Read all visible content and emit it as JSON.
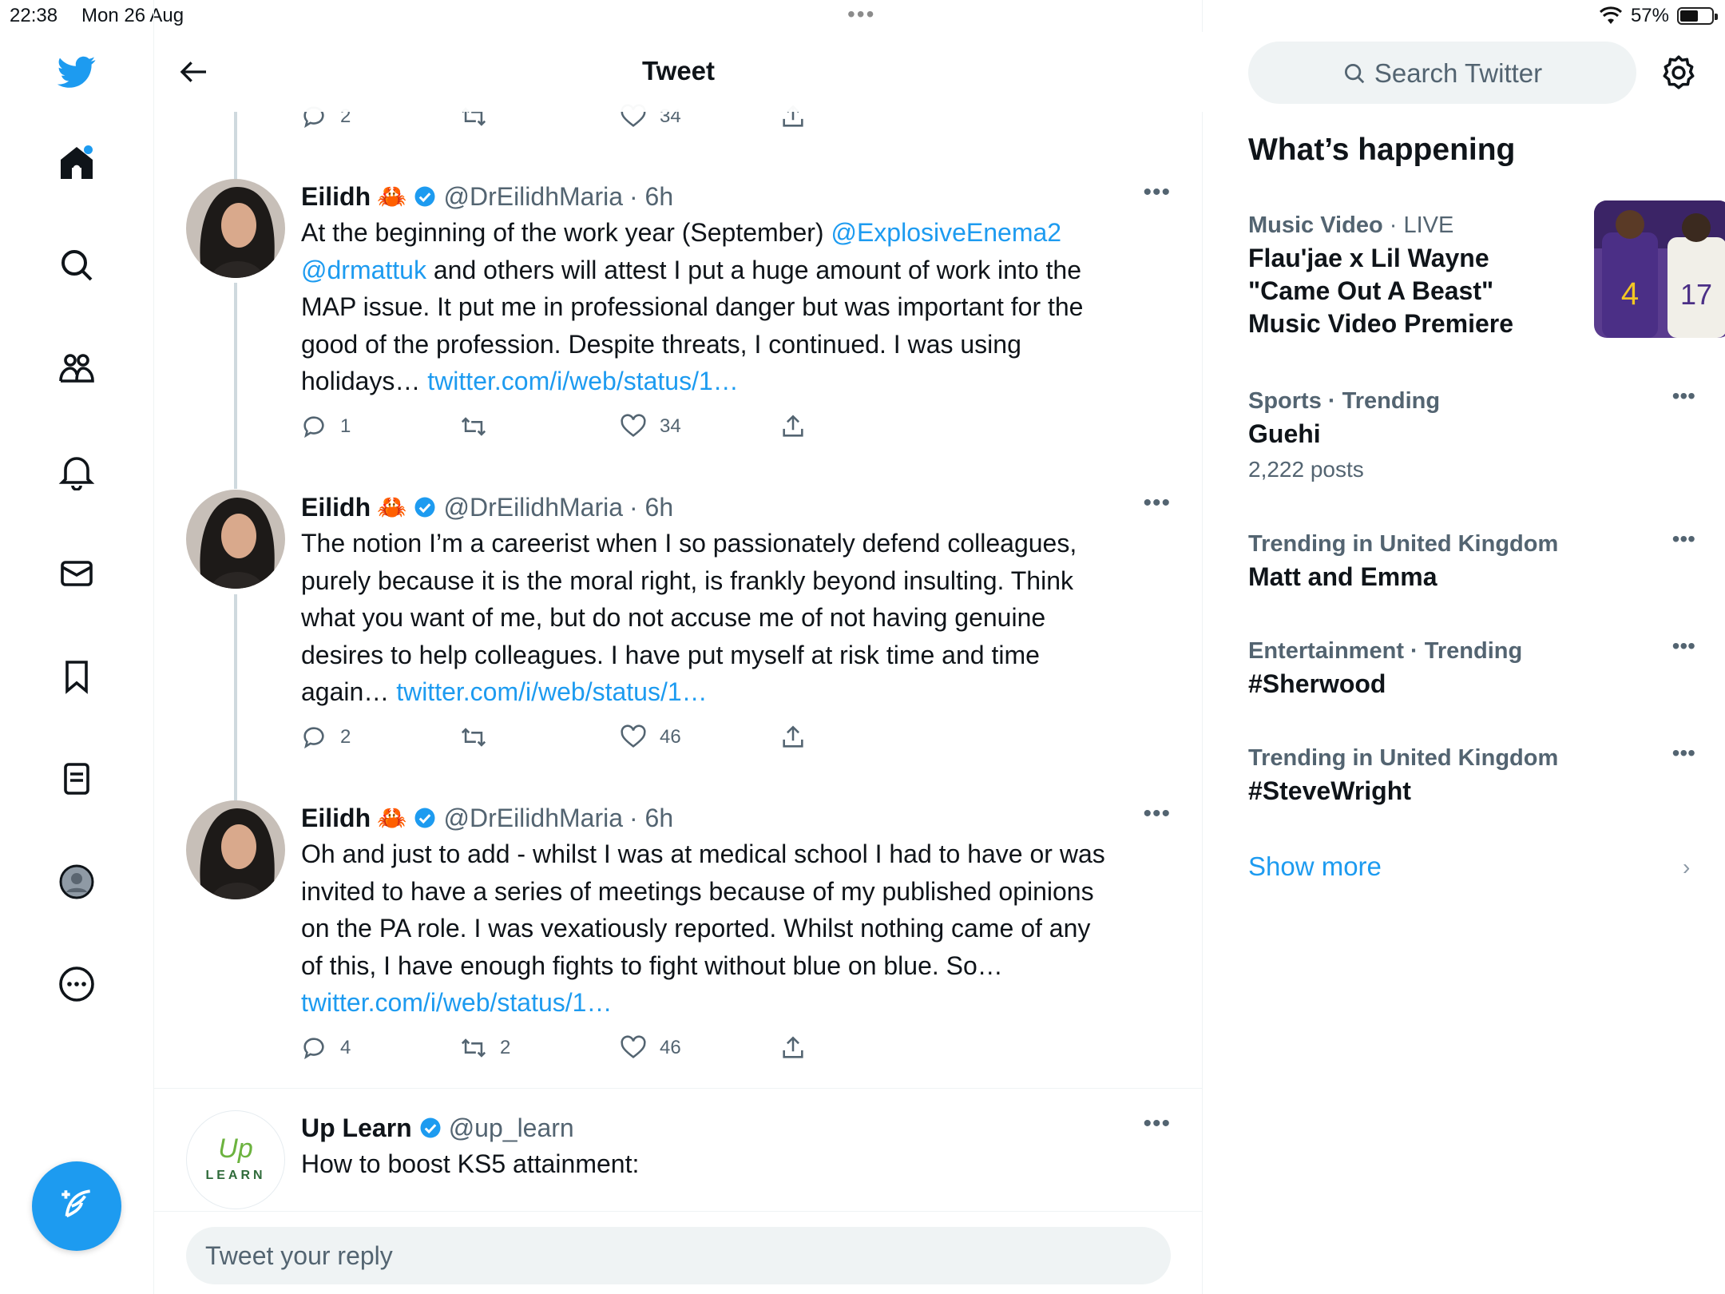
{
  "status_bar": {
    "time": "22:38",
    "date": "Mon 26 Aug",
    "battery": "57%",
    "battery_level": 0.57
  },
  "header": {
    "title": "Tweet"
  },
  "top_partial_actions": {
    "replies": "2",
    "likes": "34"
  },
  "tweets": [
    {
      "name": "Eilidh",
      "emoji": "🦀",
      "handle": "@DrEilidhMaria",
      "time": "· 6h",
      "lines": [
        [
          "At the beginning of the work year (September)  ",
          "@ExplosiveEnema2"
        ],
        [
          "@drmattuk",
          " and others will attest I put a huge amount of work into the"
        ],
        [
          "MAP issue. It put me in professional danger but was important for the"
        ],
        [
          "good of the profession. Despite threats, I continued. I was using"
        ],
        [
          "holidays… ",
          "twitter.com/i/web/status/1…"
        ]
      ],
      "replies": "1",
      "retweets": "",
      "likes": "34"
    },
    {
      "name": "Eilidh",
      "emoji": "🦀",
      "handle": "@DrEilidhMaria",
      "time": "· 6h",
      "lines": [
        [
          "The notion I’m a careerist when I so passionately defend colleagues,"
        ],
        [
          "purely because it is the moral right, is frankly beyond insulting. Think"
        ],
        [
          "what you want of me, but do not accuse me of not having genuine"
        ],
        [
          "desires to help colleagues. I have put myself at risk time and time"
        ],
        [
          "again… ",
          "twitter.com/i/web/status/1…"
        ]
      ],
      "replies": "2",
      "retweets": "",
      "likes": "46"
    },
    {
      "name": "Eilidh",
      "emoji": "🦀",
      "handle": "@DrEilidhMaria",
      "time": "· 6h",
      "lines": [
        [
          "Oh and just to add - whilst I was at medical school I had to have or was"
        ],
        [
          "invited to have a series of meetings because of my published opinions"
        ],
        [
          "on the PA role. I was vexatiously reported. Whilst nothing came of any"
        ],
        [
          "of this, I have enough fights to fight without blue on blue. So…"
        ],
        [
          "twitter.com/i/web/status/1…"
        ]
      ],
      "replies": "4",
      "retweets": "2",
      "likes": "46"
    }
  ],
  "promoted_tweet": {
    "name": "Up Learn",
    "handle": "@up_learn",
    "text": "How to boost KS5 attainment:",
    "logo_top": "Up",
    "logo_bottom": "LEARN"
  },
  "reply_input": {
    "placeholder": "Tweet your reply"
  },
  "right": {
    "search_placeholder": "Search Twitter",
    "section_title": "What’s happening",
    "trends": [
      {
        "category": "Music Video",
        "suffix": "· LIVE",
        "title": "Flau'jae x Lil Wayne \"Came Out A Beast\" Music Video Premiere",
        "count": ""
      },
      {
        "category": "Sports · Trending",
        "suffix": "",
        "title": "Guehi",
        "count": "2,222 posts"
      },
      {
        "category": "Trending in United Kingdom",
        "suffix": "",
        "title": "Matt and Emma",
        "count": ""
      },
      {
        "category": "Entertainment · Trending",
        "suffix": "",
        "title": "#Sherwood",
        "count": ""
      },
      {
        "category": "Trending in United Kingdom",
        "suffix": "",
        "title": "#SteveWright",
        "count": ""
      }
    ],
    "show_more": "Show more"
  },
  "colors": {
    "accent": "#1d9bf0",
    "secondary_text": "#536471",
    "border": "#eff3f4"
  },
  "icons": [
    "twitter-logo-icon",
    "home-icon",
    "search-icon",
    "communities-icon",
    "notifications-icon",
    "messages-icon",
    "bookmarks-icon",
    "lists-icon",
    "profile-icon",
    "more-icon",
    "compose-icon",
    "back-arrow-icon",
    "reply-icon",
    "retweet-icon",
    "like-icon",
    "share-icon",
    "verified-icon",
    "settings-icon",
    "more-dots-icon",
    "chevron-right-icon",
    "wifi-icon",
    "battery-icon"
  ]
}
